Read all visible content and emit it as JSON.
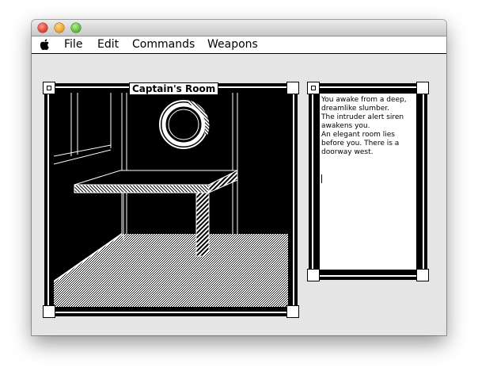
{
  "menubar": {
    "apple_icon": "apple-icon",
    "items": [
      "File",
      "Edit",
      "Commands",
      "Weapons"
    ]
  },
  "scene_window": {
    "title": "Captain's Room"
  },
  "text_window": {
    "lines": [
      "You awake from a deep, dreamlike slumber.",
      "The intruder alert siren awakens you.",
      "An elegant room lies before you. There is a doorway west."
    ]
  },
  "colors": {
    "window_bg": "#e5e5e5",
    "foreground": "#000000",
    "background": "#ffffff"
  }
}
